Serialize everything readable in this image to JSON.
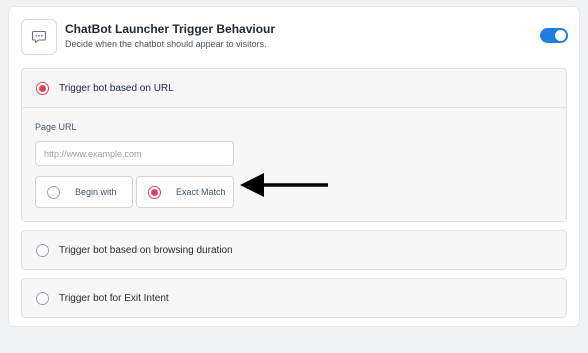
{
  "header": {
    "title": "ChatBot Launcher Trigger Behaviour",
    "subtitle": "Decide when the chatbot should appear to visitors.",
    "icon": "chat-bubble-icon",
    "toggle_on": true,
    "accent_color": "#1d7fe0"
  },
  "options": [
    {
      "label": "Trigger bot based on URL",
      "selected": true,
      "page_url_label": "Page URL",
      "url_placeholder": "http://www.example.com",
      "url_value": "",
      "match_modes": [
        {
          "label": "Begin with",
          "selected": false
        },
        {
          "label": "Exact Match",
          "selected": true
        }
      ]
    },
    {
      "label": "Trigger bot based on browsing duration",
      "selected": false
    },
    {
      "label": "Trigger bot for Exit Intent",
      "selected": false
    }
  ],
  "radio_selected_color": "#e0445a",
  "annotation": "arrow-left-icon"
}
